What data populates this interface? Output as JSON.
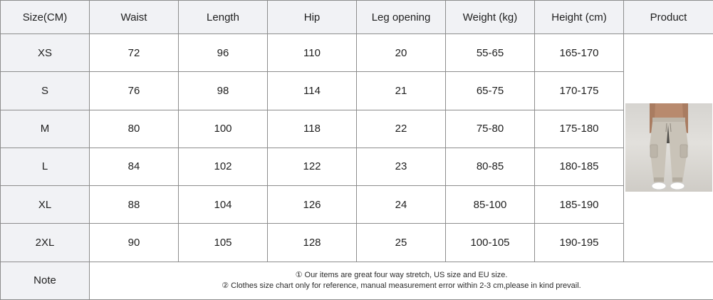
{
  "headers": [
    "Size(CM)",
    "Waist",
    "Length",
    "Hip",
    "Leg opening",
    "Weight (kg)",
    "Height (cm)",
    "Product"
  ],
  "rows": [
    {
      "size": "XS",
      "waist": "72",
      "length": "96",
      "hip": "110",
      "leg": "20",
      "weight": "55-65",
      "height": "165-170"
    },
    {
      "size": "S",
      "waist": "76",
      "length": "98",
      "hip": "114",
      "leg": "21",
      "weight": "65-75",
      "height": "170-175"
    },
    {
      "size": "M",
      "waist": "80",
      "length": "100",
      "hip": "118",
      "leg": "22",
      "weight": "75-80",
      "height": "175-180"
    },
    {
      "size": "L",
      "waist": "84",
      "length": "102",
      "hip": "122",
      "leg": "23",
      "weight": "80-85",
      "height": "180-185"
    },
    {
      "size": "XL",
      "waist": "88",
      "length": "104",
      "hip": "126",
      "leg": "24",
      "weight": "85-100",
      "height": "185-190"
    },
    {
      "size": "2XL",
      "waist": "90",
      "length": "105",
      "hip": "128",
      "leg": "25",
      "weight": "100-105",
      "height": "190-195"
    }
  ],
  "note": {
    "label": "Note",
    "line1": "① Our items are great four way stretch, US size and EU size.",
    "line2": "② Clothes size chart only for reference, manual measurement error within 2-3 cm,please in kind prevail."
  },
  "product_image": {
    "icon": "cargo-jogger-pants-photo",
    "pants_color": "#c9c3b8",
    "background_color": "#dcdad6"
  },
  "colors": {
    "header_bg": "#f1f2f5",
    "border": "#8d8d8d",
    "text": "#1f1f1f"
  }
}
